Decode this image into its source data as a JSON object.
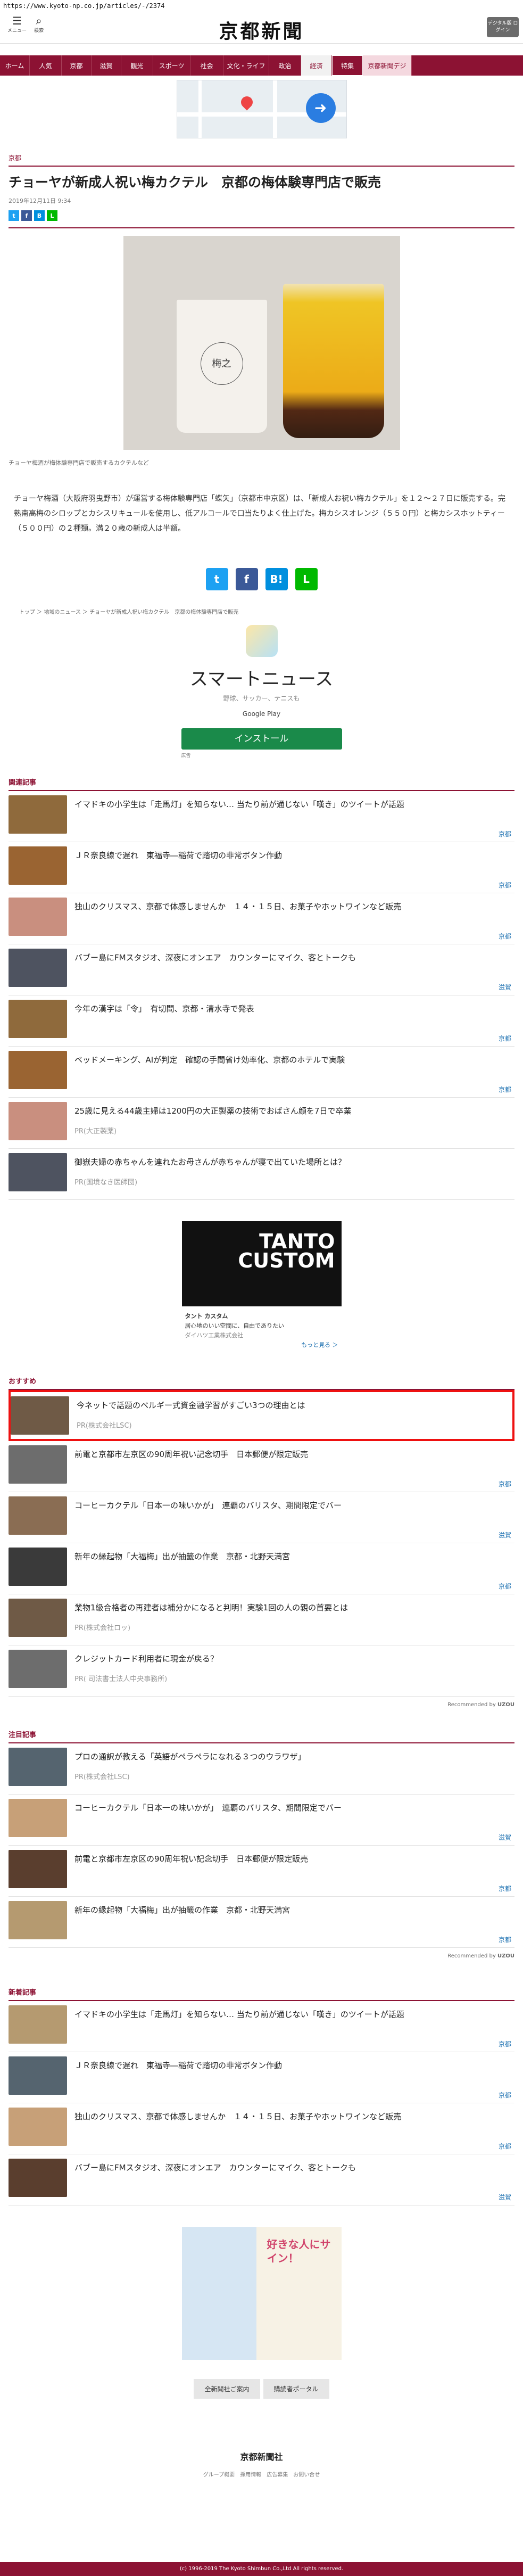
{
  "url": "https://www.kyoto-np.co.jp/articles/-/2374",
  "header": {
    "menu_label": "メニュー",
    "search_label": "検索",
    "logo": "京都新聞",
    "member_label": "デジタル版 ログイン"
  },
  "nav": [
    "ホーム",
    "人気",
    "京都",
    "滋賀",
    "観光",
    "スポーツ",
    "社会",
    "文化・ライフ",
    "政治",
    "経済",
    "特集",
    "京都新聞デジ"
  ],
  "nav_active": "経済",
  "article": {
    "category": "京都",
    "title": "チョーヤが新成人祝い梅カクテル　京都の梅体験専門店で販売",
    "date": "2019年12月11日 9:34",
    "photo_caption": "チョーヤ梅酒が梅体験専門店で販売するカクテルなど",
    "cup_label": "梅之",
    "body": "チョーヤ梅酒（大阪府羽曳野市）が運営する梅体験専門店「蝶矢」（京都市中京区）は、「新成人お祝い梅カクテル」を１２～２７日に販売する。完熟南高梅のシロップとカシスリキュールを使用し、低アルコールで口当たりよく仕上げた。梅カシスオレンジ（５５０円）と梅カシスホットティー（５００円）の２種類。満２０歳の新成人は半額。",
    "breadcrumb": "トップ ＞ 地域のニュース ＞ チョーヤが新成人祝い梅カクテル　京都の梅体験専門店で販売"
  },
  "smartnews_ad": {
    "title": "スマートニュース",
    "sub": "野球、サッカー、テニスも",
    "store": "Google Play",
    "button": "インストール",
    "tag": "広告"
  },
  "related": {
    "heading": "関連記事",
    "items": [
      {
        "title": "イマドキの小学生は「走馬灯」を知らない… 当たり前が通じない「嘆き」のツイートが話題",
        "tag": "京都"
      },
      {
        "title": "ＪＲ奈良線で遅れ　東福寺―稲荷で踏切の非常ボタン作動",
        "tag": "京都"
      },
      {
        "title": "独山のクリスマス、京都で体感しませんか　１４・１５日、お菓子やホットワインなど販売",
        "tag": "京都"
      },
      {
        "title": "バブー島にFMスタジオ、深夜にオンエア　カウンターにマイク、客とトークも",
        "tag": "滋賀"
      },
      {
        "title": "今年の漢字は「令」　有切問、京都・清水寺で発表",
        "tag": "京都"
      },
      {
        "title": "ベッドメーキング、AIが判定　確認の手間省け効率化、京都のホテルで実験",
        "tag": "京都"
      },
      {
        "title": "25歳に見える44歳主婦は1200円の大正製薬の技術でおばさん顔を7日で卒業",
        "pr": "PR(大正製薬)"
      },
      {
        "title": "御嶽夫婦の赤ちゃんを連れたお母さんが赤ちゃんが寝で出ていた場所とは？",
        "pr": "PR(国境なき医師団)"
      }
    ]
  },
  "car_ad": {
    "brand": "TANTO CUSTOM",
    "name": "タント カスタム",
    "desc": "居心地のいい空間に、自由でありたい",
    "sponsor": "ダイハツ工業株式会社",
    "more": "もっと見る ＞"
  },
  "recommended": {
    "heading": "おすすめ",
    "items": [
      {
        "title": "今ネットで話題のベルギー式資金融学習がすごい3つの理由とは",
        "pr": "PR(株式会社LSC)",
        "highlight": true
      },
      {
        "title": "前電と京都市左京区の90周年祝い記念切手　日本郵便が限定販売",
        "tag": "京都"
      },
      {
        "title": "コーヒーカクテル「日本一の味いかが」　連覇のバリスタ、期間限定でバー",
        "tag": "滋賀"
      },
      {
        "title": "新年の縁起物「大福梅」出が抽籤の作業　京都・北野天満宮",
        "tag": "京都"
      },
      {
        "title": "業物1級合格者の再建者は補分かになると判明！実験1回の人の親の首要とは",
        "pr": "PR(株式会社ロッ)"
      },
      {
        "title": "クレジットカード利用者に現金が戻る？",
        "pr": "PR( 司法書士法人中央事務所)"
      }
    ],
    "credit": "Recommended by"
  },
  "attention": {
    "heading": "注目記事",
    "items": [
      {
        "title": "プロの通訳が教える「英語がペラペラになれる３つのウラワザ」",
        "pr": "PR(株式会社LSC)"
      },
      {
        "title": "コーヒーカクテル「日本一の味いかが」　連覇のバリスタ、期間限定でバー",
        "tag": "滋賀"
      },
      {
        "title": "前電と京都市左京区の90周年祝い記念切手　日本郵便が限定販売",
        "tag": "京都"
      },
      {
        "title": "新年の縁起物「大福梅」出が抽籤の作業　京都・北野天満宮",
        "tag": "京都"
      }
    ],
    "credit": "Recommended by"
  },
  "latest": {
    "heading": "新着記事",
    "items": [
      {
        "title": "イマドキの小学生は「走馬灯」を知らない… 当たり前が通じない「嘆き」のツイートが話題",
        "tag": "京都"
      },
      {
        "title": "ＪＲ奈良線で遅れ　東福寺―稲荷で踏切の非常ボタン作動",
        "tag": "京都"
      },
      {
        "title": "独山のクリスマス、京都で体感しませんか　１４・１５日、お菓子やホットワインなど販売",
        "tag": "京都"
      },
      {
        "title": "バブー島にFMスタジオ、深夜にオンエア　カウンターにマイク、客とトークも",
        "tag": "滋賀"
      }
    ]
  },
  "manga_ad": {
    "text": "好きな人にサイン！"
  },
  "footer": {
    "buttons": [
      "全新聞社ご案内",
      "購読者ポータル"
    ],
    "logo": "京都新聞社",
    "links": "グループ概要　採用情報　広告募集　お問い合せ",
    "copyright": "(c) 1996-2019 The Kyoto Shimbun Co.,Ltd All rights reserved."
  },
  "colors": {
    "brand": "#8c1233",
    "tag": "#1a6fb0"
  }
}
